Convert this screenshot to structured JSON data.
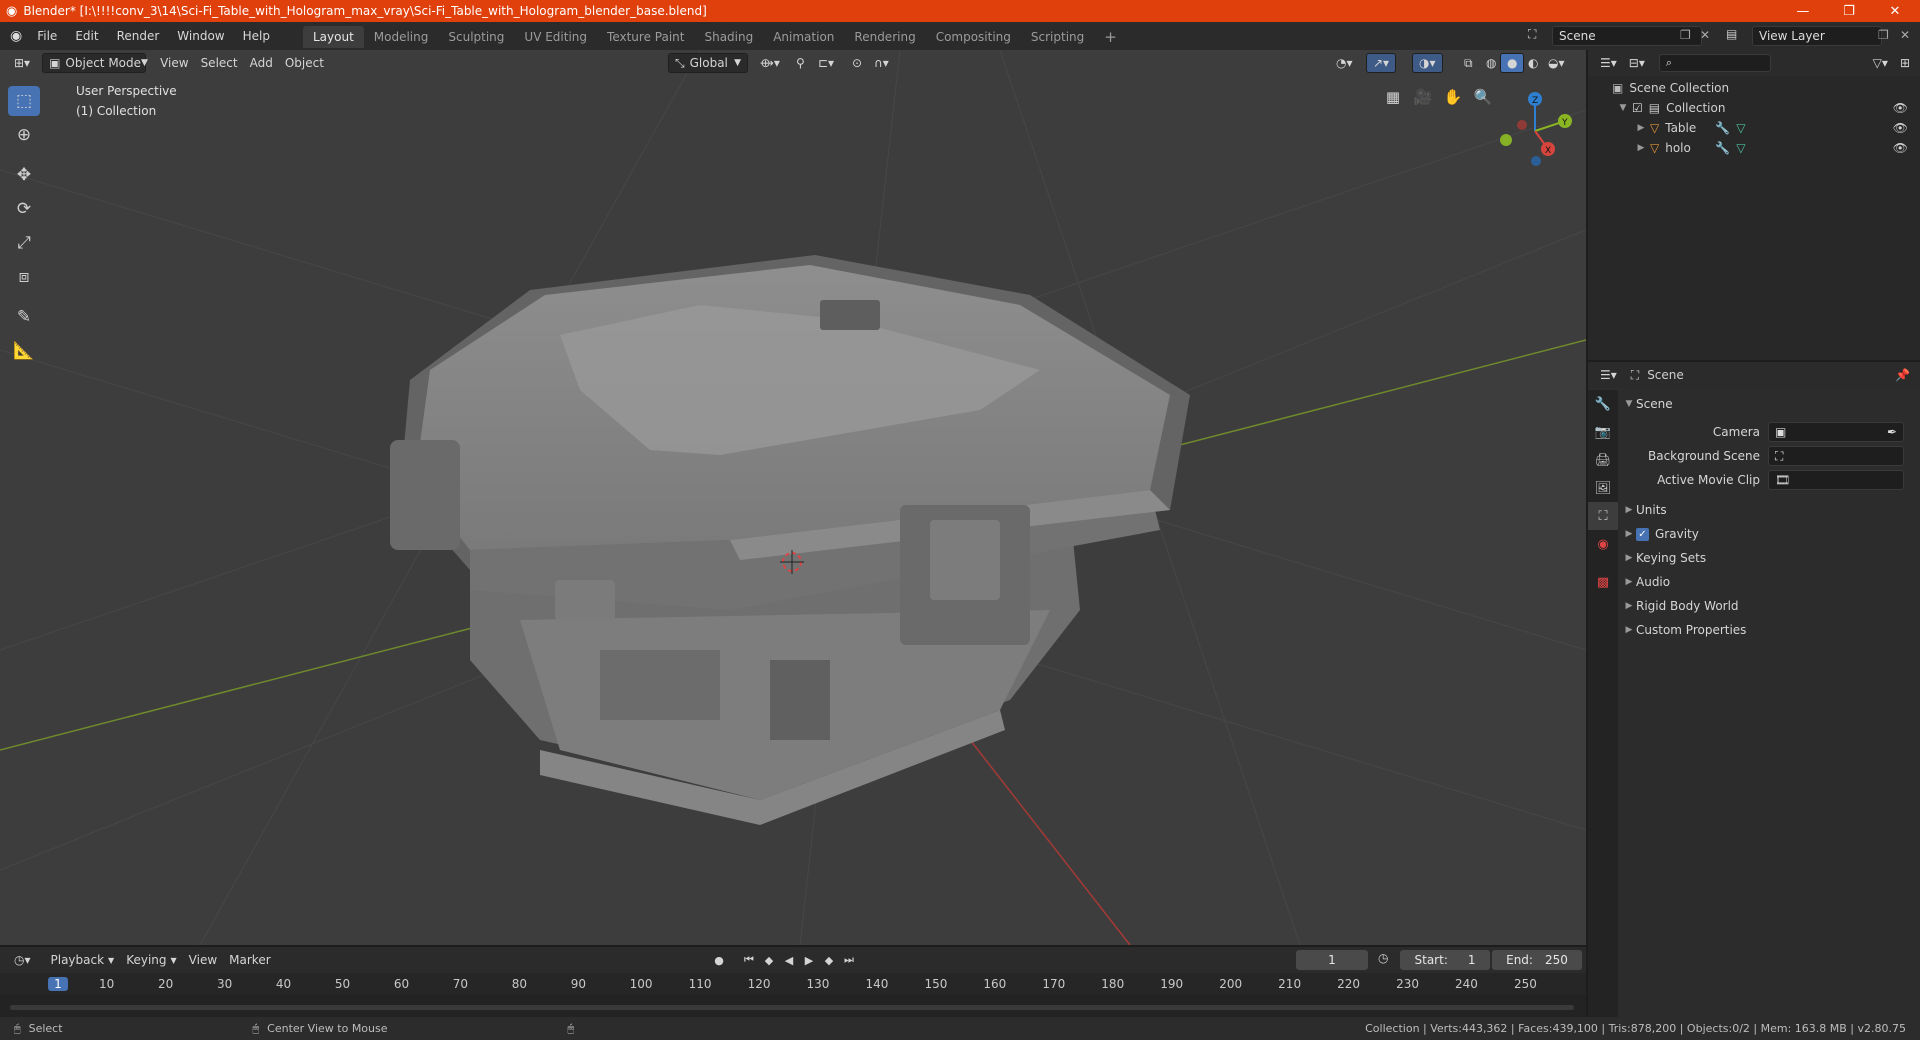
{
  "window": {
    "title": "Blender* [I:\\!!!!conv_3\\14\\Sci-Fi_Table_with_Hologram_max_vray\\Sci-Fi_Table_with_Hologram_blender_base.blend]",
    "minimize_icon": "minimize-icon",
    "restore_icon": "restore-icon",
    "close_icon": "close-icon"
  },
  "menubar": {
    "items": [
      "File",
      "Edit",
      "Render",
      "Window",
      "Help"
    ],
    "workspaces": [
      "Layout",
      "Modeling",
      "Sculpting",
      "UV Editing",
      "Texture Paint",
      "Shading",
      "Animation",
      "Rendering",
      "Compositing",
      "Scripting"
    ],
    "active_workspace": "Layout",
    "scene_name": "Scene",
    "view_layer": "View Layer"
  },
  "viewport": {
    "mode": "Object Mode",
    "menus": [
      "View",
      "Select",
      "Add",
      "Object"
    ],
    "orientation": "Global",
    "perspective_label": "User Perspective",
    "collection_label": "(1) Collection",
    "gizmo_axes": [
      "X",
      "Y",
      "Z"
    ]
  },
  "outliner": {
    "root": "Scene Collection",
    "collection": "Collection",
    "objects": [
      "Table",
      "holo"
    ]
  },
  "properties": {
    "header": "Scene",
    "panel": "Scene",
    "camera_label": "Camera",
    "background_scene_label": "Background Scene",
    "movie_clip_label": "Active Movie Clip",
    "sections": [
      "Units",
      "Gravity",
      "Keying Sets",
      "Audio",
      "Rigid Body World",
      "Custom Properties"
    ],
    "gravity_checked": true
  },
  "timeline": {
    "menus": [
      "Playback",
      "Keying",
      "View",
      "Marker"
    ],
    "current_frame": "1",
    "start_label": "Start:",
    "start": "1",
    "end_label": "End:",
    "end": "250",
    "ruler": [
      "1",
      "10",
      "20",
      "30",
      "40",
      "50",
      "60",
      "70",
      "80",
      "90",
      "100",
      "110",
      "120",
      "130",
      "140",
      "150",
      "160",
      "170",
      "180",
      "190",
      "200",
      "210",
      "220",
      "230",
      "240",
      "250"
    ]
  },
  "statusbar": {
    "select": "Select",
    "center_view": "Center View to Mouse",
    "stats": "Collection | Verts:443,362 | Faces:439,100 | Tris:878,200 | Objects:0/2 | Mem: 163.8 MB | v2.80.75"
  },
  "colors": {
    "titlebar": "#e0400c",
    "accent": "#4772b3",
    "x_axis": "#d6453d",
    "y_axis": "#8ab624",
    "z_axis": "#2f7fd0"
  }
}
